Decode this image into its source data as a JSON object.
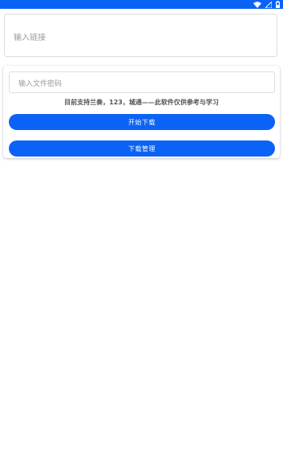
{
  "colors": {
    "accent": "#0b62f6",
    "status_bar": "#0b62f6",
    "placeholder_text": "#9a9a9a",
    "notice_text": "#555555"
  },
  "status_bar": {
    "icons": [
      "wifi-icon",
      "signal-icon",
      "battery-icon"
    ]
  },
  "link_input": {
    "placeholder": "输入链接",
    "value": ""
  },
  "password_input": {
    "placeholder": "输入文件密码",
    "value": ""
  },
  "notice": "目前支持兰奏，123，城通——此软件仅供参考与学习",
  "buttons": {
    "start_download": "开始下载",
    "download_manage": "下载管理"
  }
}
